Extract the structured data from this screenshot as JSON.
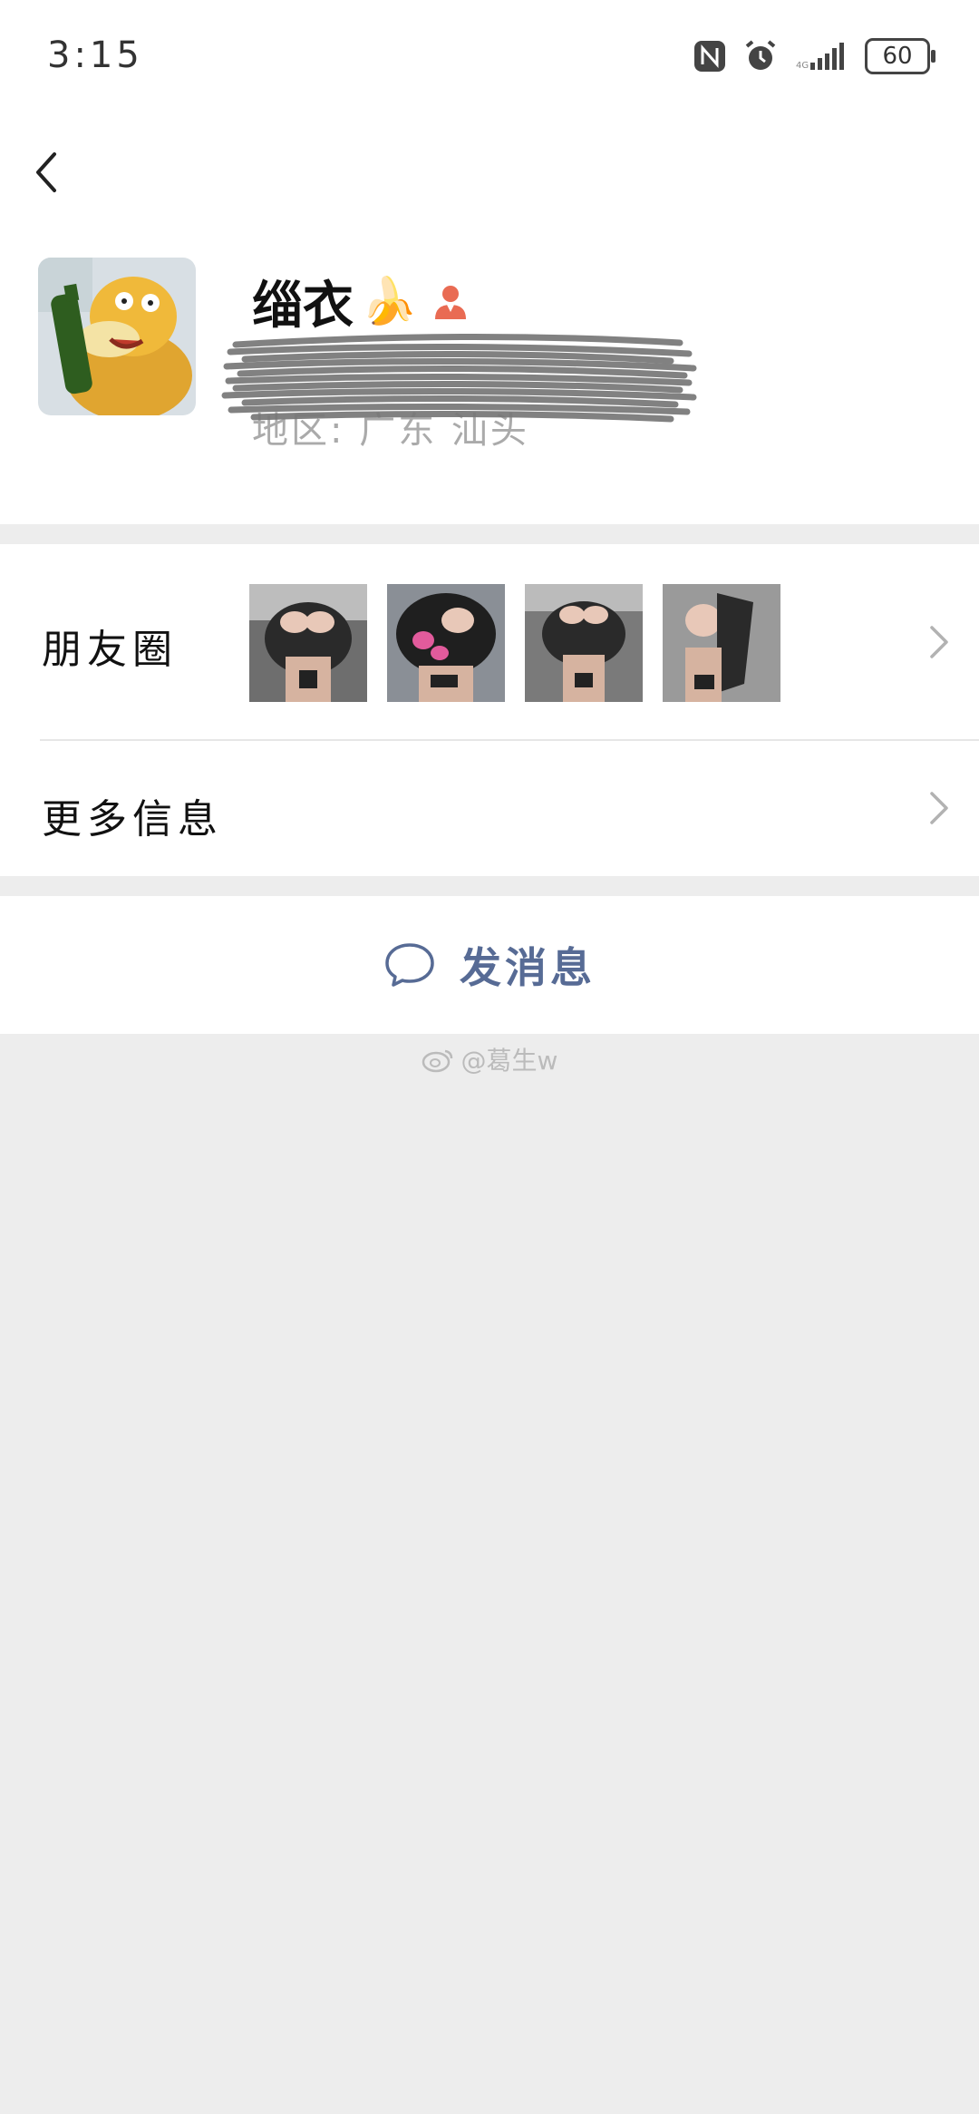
{
  "status_bar": {
    "time": "3:15",
    "battery": "60",
    "icons": [
      "nfc-icon",
      "alarm-icon",
      "signal-icon",
      "battery-icon"
    ]
  },
  "nav": {
    "back_icon": "chevron-left-icon"
  },
  "profile": {
    "name": "缁衣",
    "name_emoji": "🍌",
    "gender_icon": "female-person-icon",
    "region": "地区: 广东 汕头",
    "avatar_description_icon": "avatar-image"
  },
  "list": {
    "moments_label": "朋友圈",
    "more_info_label": "更多信息",
    "moments_thumbnails_count": 4
  },
  "actions": {
    "send_message_label": "发消息",
    "send_message_icon": "chat-bubble-icon"
  },
  "watermark": {
    "text": "@葛生w",
    "icon": "weibo-icon"
  },
  "colors": {
    "link_blue": "#576b95",
    "background_gray": "#ededed",
    "white": "#ffffff"
  }
}
